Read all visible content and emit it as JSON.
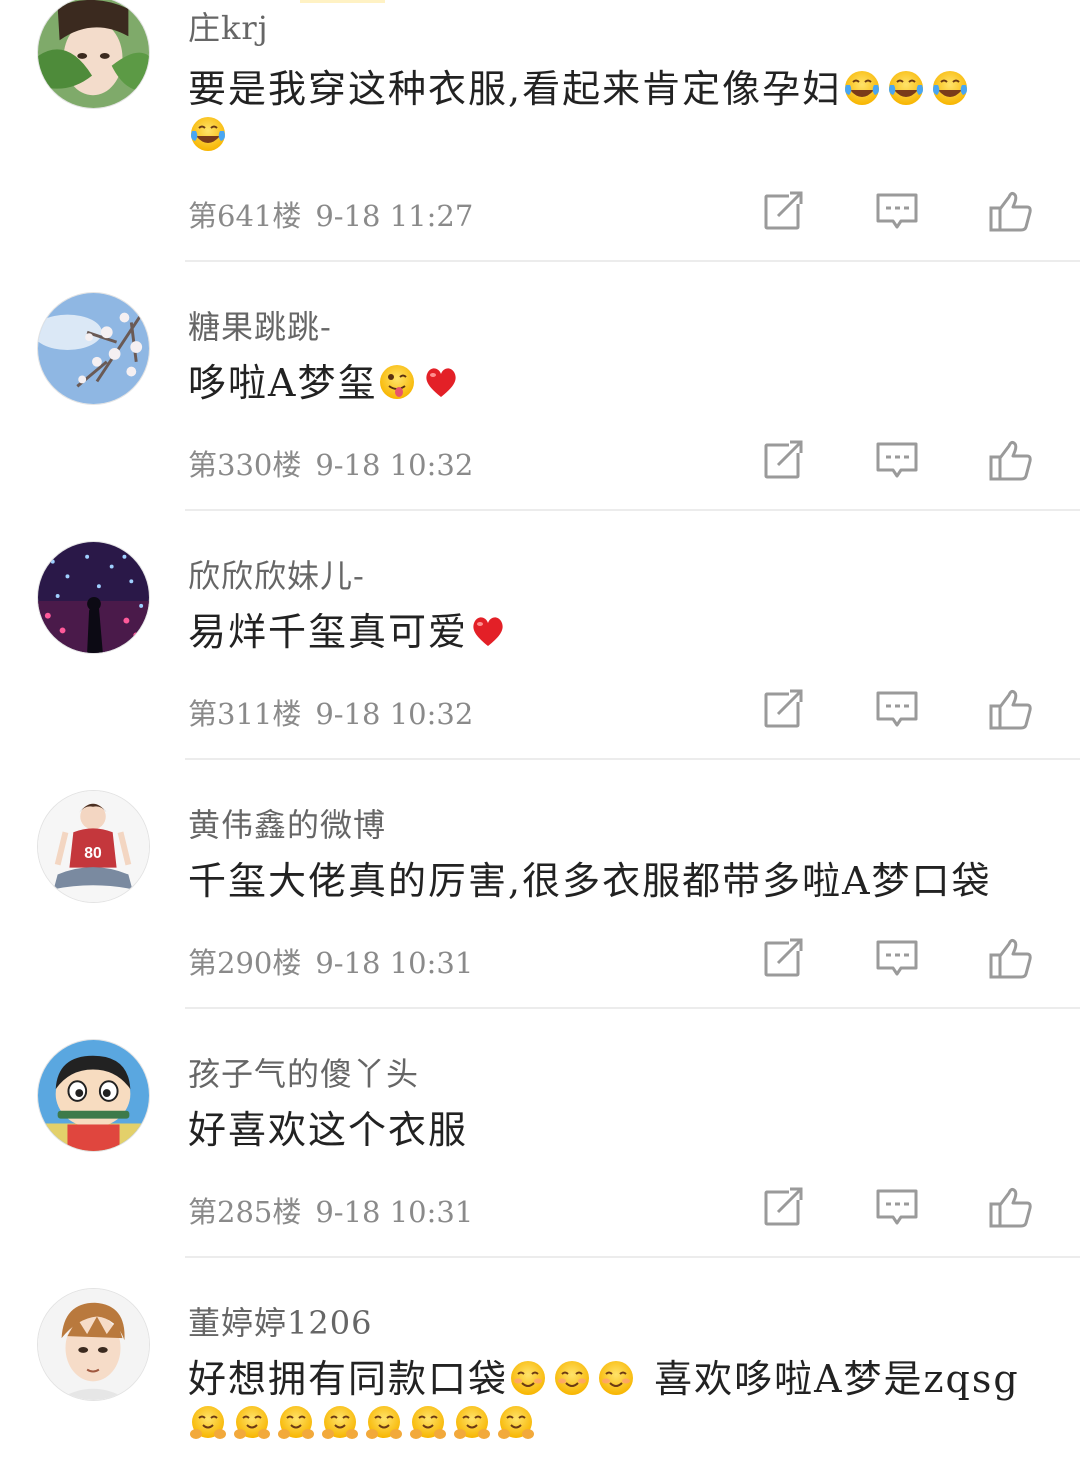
{
  "comments": [
    {
      "username": "庄krj",
      "text": "要是我穿这种衣服,看起来肯定像孕妇",
      "emojis": [
        "laugh-cry-emoji",
        "laugh-cry-emoji",
        "laugh-cry-emoji",
        "laugh-cry-emoji"
      ],
      "floor": "第641楼",
      "time": "9-18 11:27",
      "avatar": "girl-with-leaf-avatar"
    },
    {
      "username": "糖果跳跳-",
      "text": "哆啦A梦玺",
      "emojis": [
        "wink-tongue-emoji",
        "heart-emoji"
      ],
      "floor": "第330楼",
      "time": "9-18 10:32",
      "avatar": "blossom-sky-avatar"
    },
    {
      "username": "欣欣欣妹儿-",
      "text": "易烊千玺真可爱",
      "emojis": [
        "heart-emoji"
      ],
      "floor": "第311楼",
      "time": "9-18 10:32",
      "avatar": "starry-lights-avatar"
    },
    {
      "username": "黄伟鑫的微博",
      "text": "千玺大佬真的厉害,很多衣服都带多啦A梦口袋",
      "emojis": [],
      "floor": "第290楼",
      "time": "9-18 10:31",
      "avatar": "boy-jersey-80-avatar"
    },
    {
      "username": "孩子气的傻丫头",
      "text": "好喜欢这个衣服",
      "emojis": [],
      "floor": "第285楼",
      "time": "9-18 10:31",
      "avatar": "cartoon-boy-avatar"
    },
    {
      "username": "董婷婷1206",
      "text_a": "好想拥有同款口袋",
      "emojis_a": [
        "smile-emoji",
        "smile-emoji",
        "smile-emoji"
      ],
      "text_b": " 喜欢哆啦A梦是zqsg",
      "emojis_b": [
        "hug-emoji",
        "hug-emoji",
        "hug-emoji",
        "hug-emoji",
        "hug-emoji",
        "hug-emoji",
        "hug-emoji",
        "hug-emoji"
      ],
      "avatar": "anime-boy-avatar"
    }
  ],
  "actions": [
    "repost-icon",
    "comment-icon",
    "like-icon"
  ],
  "colors": {
    "text": "#222222",
    "meta": "#8a8a8a",
    "username": "#666666",
    "divider": "#ececec",
    "icon": "#9a9a9a"
  }
}
